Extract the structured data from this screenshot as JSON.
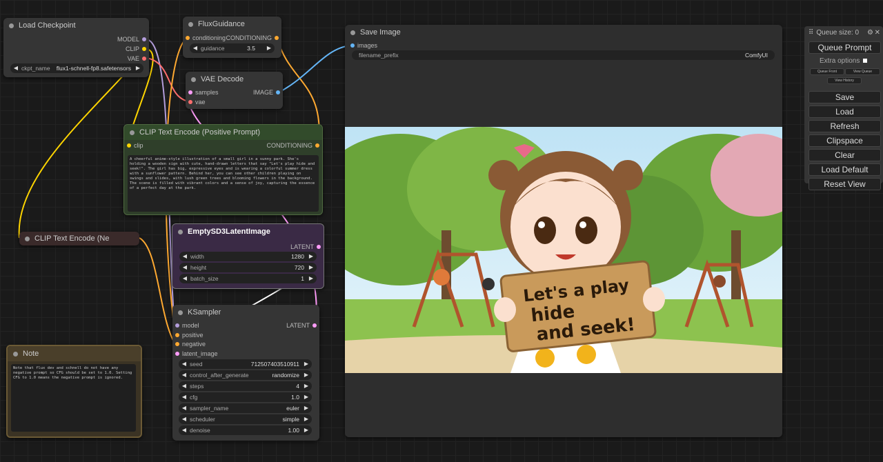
{
  "colors": {
    "model": "#b39ddb",
    "clip": "#ffd500",
    "vae": "#ff6e6e",
    "conditioning": "#ffa931",
    "latent": "#ff9cf9",
    "image": "#64b5f6",
    "int": "#7fd07f"
  },
  "load_checkpoint": {
    "title": "Load Checkpoint",
    "outputs": [
      "MODEL",
      "CLIP",
      "VAE"
    ],
    "widget": {
      "name": "ckpt_name",
      "value": "flux1-schnell-fp8.safetensors"
    }
  },
  "flux_guidance": {
    "title": "FluxGuidance",
    "input": "conditioning",
    "output": "CONDITIONING",
    "widget": {
      "name": "guidance",
      "value": "3.5"
    }
  },
  "vae_decode": {
    "title": "VAE Decode",
    "inputs": [
      "samples",
      "vae"
    ],
    "output": "IMAGE"
  },
  "clip_pos": {
    "title": "CLIP Text Encode (Positive Prompt)",
    "input": "clip",
    "output": "CONDITIONING",
    "text": "A cheerful anime-style illustration of a small girl in a sunny park. She's holding a wooden sign with cute, hand-drawn letters that say \"Let's play hide and seek!\". The girl has big, expressive eyes and is wearing a colorful summer dress with a sunflower pattern. Behind her, you can see other children playing on swings and slides, with lush green trees and blooming flowers in the background. The scene is filled with vibrant colors and a sense of joy, capturing the essence of a perfect day at the park."
  },
  "clip_neg": {
    "title": "CLIP Text Encode (Ne"
  },
  "empty_latent": {
    "title": "EmptySD3LatentImage",
    "output": "LATENT",
    "widgets": [
      {
        "name": "width",
        "value": "1280"
      },
      {
        "name": "height",
        "value": "720"
      },
      {
        "name": "batch_size",
        "value": "1"
      }
    ]
  },
  "ksampler": {
    "title": "KSampler",
    "inputs": [
      "model",
      "positive",
      "negative",
      "latent_image"
    ],
    "output": "LATENT",
    "widgets": [
      {
        "name": "seed",
        "value": "712507403510911"
      },
      {
        "name": "control_after_generate",
        "value": "randomize"
      },
      {
        "name": "steps",
        "value": "4"
      },
      {
        "name": "cfg",
        "value": "1.0"
      },
      {
        "name": "sampler_name",
        "value": "euler"
      },
      {
        "name": "scheduler",
        "value": "simple"
      },
      {
        "name": "denoise",
        "value": "1.00"
      }
    ]
  },
  "note": {
    "title": "Note",
    "text": "Note that flux dev and schnell do not have any negative prompt so CFG should be set to 1.0. Setting CFG to 1.0 means the negative prompt is ignored."
  },
  "save_image": {
    "title": "Save Image",
    "input": "images",
    "widget": {
      "name": "filename_prefix",
      "value": "ComfyUI"
    },
    "sign_text": [
      "Let's a play",
      "hide",
      "and seek!"
    ]
  },
  "queue_panel": {
    "queue_size": "Queue size: 0",
    "queue_prompt": "Queue Prompt",
    "extra_options": "Extra options",
    "small_buttons": [
      "Queue Front",
      "View Queue",
      "View History"
    ],
    "buttons": [
      "Save",
      "Load",
      "Refresh",
      "Clipspace",
      "Clear",
      "Load Default",
      "Reset View"
    ]
  }
}
